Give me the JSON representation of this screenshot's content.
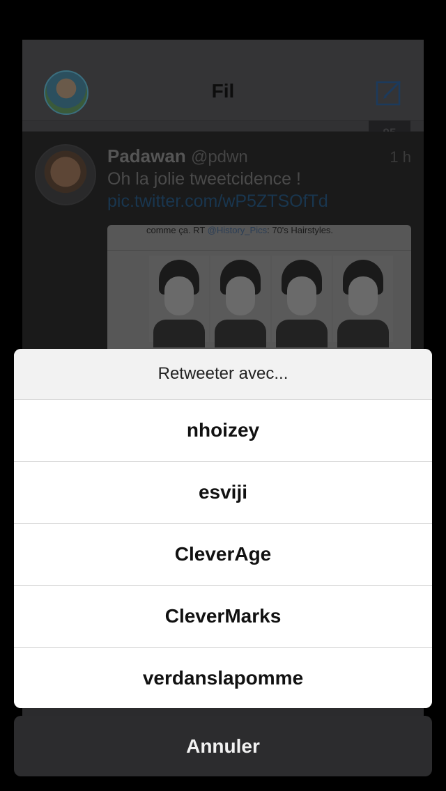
{
  "nav": {
    "title": "Fil"
  },
  "tweet": {
    "count": "95",
    "name": "Padawan",
    "handle": "@pdwn",
    "time": "1 h",
    "text": "Oh la jolie tweetcidence !",
    "link": "pic.twitter.com/wP5ZTSOfTd",
    "media_caption_prefix": "comme ça. RT ",
    "media_caption_mention": "@History_Pics",
    "media_caption_suffix": ": 70's Hairstyles."
  },
  "sheet": {
    "title": "Retweeter avec...",
    "options": [
      {
        "label": "nhoizey"
      },
      {
        "label": "esviji"
      },
      {
        "label": "CleverAge"
      },
      {
        "label": "CleverMarks"
      },
      {
        "label": "verdanslapomme"
      }
    ],
    "cancel_label": "Annuler"
  },
  "colors": {
    "accent": "#2f6fb8",
    "sheet_bg": "#ffffff",
    "cancel_bg": "#2c2c2e"
  },
  "icons": {
    "compose": "compose-icon",
    "avatar": "avatar"
  }
}
